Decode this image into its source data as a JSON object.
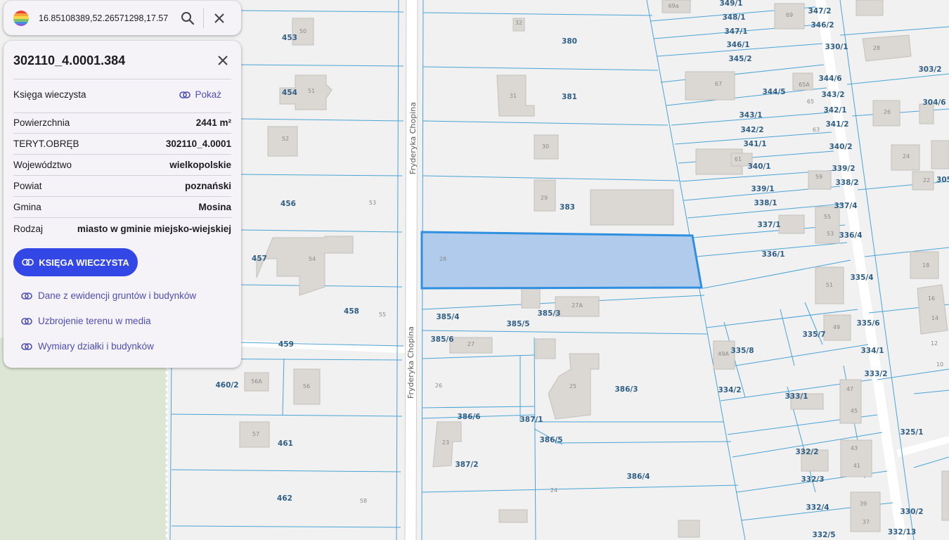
{
  "search": {
    "value": "16.85108389,52.26571298,17.57"
  },
  "icons": {
    "logo": "app-logo-icon",
    "search": "search-icon",
    "close": "close-icon",
    "link": "link-icon"
  },
  "colors": {
    "accent": "#3346e6",
    "link": "#4d4fb5",
    "selection_fill": "#b0cbec",
    "selection_stroke": "#2f8fe0",
    "plot_line": "#4aa4d6"
  },
  "panel": {
    "title": "302110_4.0001.384",
    "land_register_label": "Księga wieczysta",
    "land_register_link": "Pokaż",
    "properties": [
      {
        "label": "Powierzchnia",
        "value": "2441 m²"
      },
      {
        "label": "TERYT.OBRĘB",
        "value": "302110_4.0001"
      },
      {
        "label": "Województwo",
        "value": "wielkopolskie"
      },
      {
        "label": "Powiat",
        "value": "poznański"
      },
      {
        "label": "Gmina",
        "value": "Mosina"
      },
      {
        "label": "Rodzaj",
        "value": "miasto w gminie miejsko-wiejskiej"
      }
    ],
    "primary_button": "KSIĘGA WIECZYSTA",
    "links": [
      "Dane z ewidencji gruntów i budynków",
      "Uzbrojenie terenu w media",
      "Wymiary działki i budynków"
    ]
  },
  "map": {
    "street_name": "Fryderyka Chopina",
    "plot_labels": [
      "453",
      "454",
      "456",
      "457",
      "458",
      "459",
      "460/2",
      "461",
      "462",
      "380",
      "381",
      "383",
      "385/4",
      "385/5",
      "385/3",
      "385/6",
      "386/3",
      "386/6",
      "387/1",
      "386/5",
      "387/2",
      "386/4",
      "349/1",
      "348/1",
      "347/1",
      "346/1",
      "345/2",
      "347/2",
      "346/2",
      "330/1",
      "303/2",
      "344/6",
      "344/5",
      "343/2",
      "343/1",
      "342/1",
      "342/2",
      "341/2",
      "341/1",
      "340/2",
      "340/1",
      "339/2",
      "339/1",
      "338/2",
      "338/1",
      "337/4",
      "337/1",
      "336/4",
      "336/1",
      "304/6",
      "305",
      "335/4",
      "335/6",
      "335/7",
      "335/8",
      "334/1",
      "334/2",
      "333/2",
      "333/1",
      "325/1",
      "332/2",
      "332/3",
      "332/4",
      "330/2",
      "332/5",
      "332/13"
    ],
    "building_numbers": [
      "50",
      "51",
      "52",
      "53",
      "54",
      "55",
      "56A",
      "56",
      "57",
      "58",
      "32",
      "31",
      "30",
      "29",
      "28",
      "27A",
      "27",
      "26",
      "25",
      "23",
      "24",
      "69a",
      "69",
      "28",
      "26",
      "24",
      "22",
      "18",
      "16",
      "14",
      "12",
      "10",
      "67",
      "65A",
      "65",
      "63",
      "61",
      "59",
      "55",
      "53",
      "51",
      "49",
      "49A",
      "47",
      "45",
      "43",
      "41",
      "39",
      "37"
    ]
  }
}
